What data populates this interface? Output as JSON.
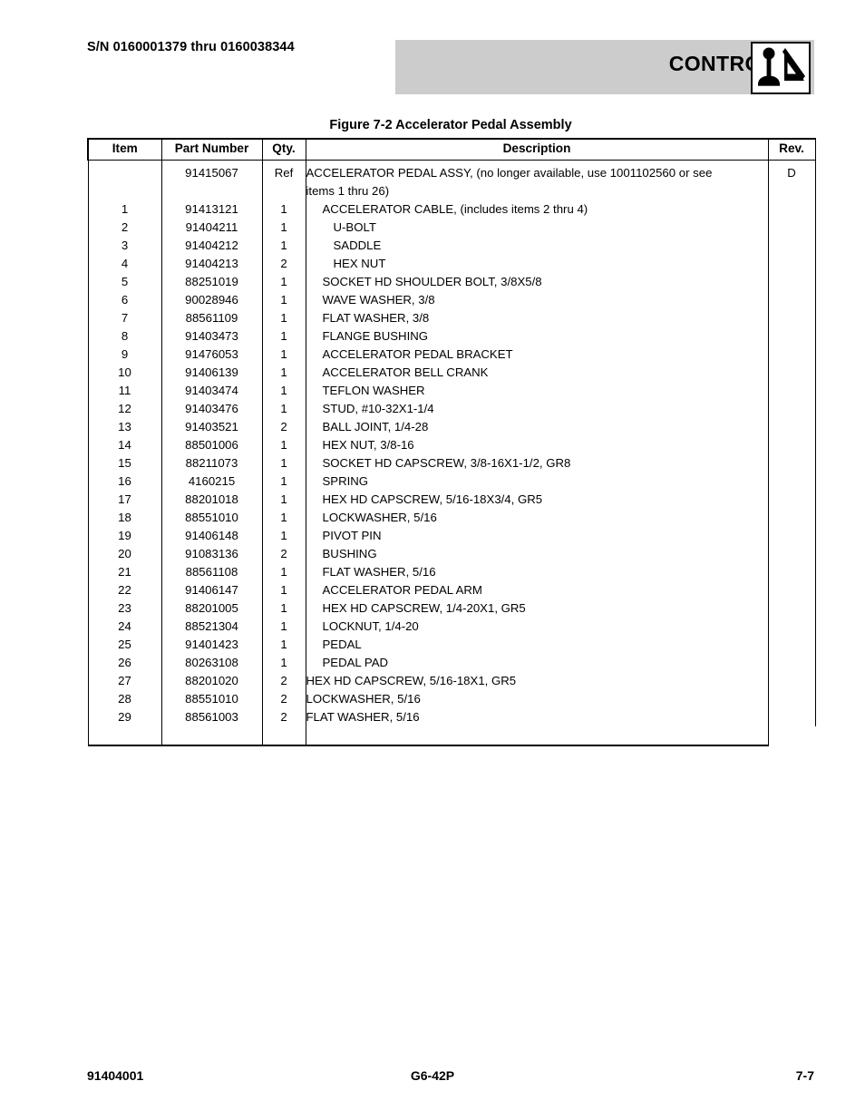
{
  "header": {
    "serial_range": "S/N 0160001379 thru 0160038344",
    "section_title": "CONTROLS",
    "icon_name": "controls-joystick-boom-icon",
    "banner_color": "#cccccc"
  },
  "figure": {
    "title": "Figure 7-2 Accelerator Pedal Assembly"
  },
  "table": {
    "columns": {
      "item": "Item",
      "part_number": "Part Number",
      "qty": "Qty.",
      "description": "Description",
      "rev": "Rev."
    },
    "rows": [
      {
        "item": "",
        "part": "91415067",
        "qty": "Ref",
        "desc": "ACCELERATOR PEDAL ASSY, (no longer available, use 1001102560 or see",
        "desc2": "items 1 thru 26)",
        "indent": 0,
        "rev": "D"
      },
      {
        "item": "1",
        "part": "91413121",
        "qty": "1",
        "desc": "ACCELERATOR CABLE, (includes items 2 thru 4)",
        "indent": 1,
        "rev": ""
      },
      {
        "item": "2",
        "part": "91404211",
        "qty": "1",
        "desc": "U-BOLT",
        "indent": 2,
        "rev": ""
      },
      {
        "item": "3",
        "part": "91404212",
        "qty": "1",
        "desc": "SADDLE",
        "indent": 2,
        "rev": ""
      },
      {
        "item": "4",
        "part": "91404213",
        "qty": "2",
        "desc": "HEX NUT",
        "indent": 2,
        "rev": ""
      },
      {
        "item": "5",
        "part": "88251019",
        "qty": "1",
        "desc": "SOCKET HD SHOULDER BOLT, 3/8X5/8",
        "indent": 1,
        "rev": ""
      },
      {
        "item": "6",
        "part": "90028946",
        "qty": "1",
        "desc": "WAVE WASHER, 3/8",
        "indent": 1,
        "rev": ""
      },
      {
        "item": "7",
        "part": "88561109",
        "qty": "1",
        "desc": "FLAT WASHER, 3/8",
        "indent": 1,
        "rev": ""
      },
      {
        "item": "8",
        "part": "91403473",
        "qty": "1",
        "desc": "FLANGE BUSHING",
        "indent": 1,
        "rev": ""
      },
      {
        "item": "9",
        "part": "91476053",
        "qty": "1",
        "desc": "ACCELERATOR PEDAL BRACKET",
        "indent": 1,
        "rev": ""
      },
      {
        "item": "10",
        "part": "91406139",
        "qty": "1",
        "desc": "ACCELERATOR BELL CRANK",
        "indent": 1,
        "rev": ""
      },
      {
        "item": "11",
        "part": "91403474",
        "qty": "1",
        "desc": "TEFLON WASHER",
        "indent": 1,
        "rev": ""
      },
      {
        "item": "12",
        "part": "91403476",
        "qty": "1",
        "desc": "STUD, #10-32X1-1/4",
        "indent": 1,
        "rev": ""
      },
      {
        "item": "13",
        "part": "91403521",
        "qty": "2",
        "desc": "BALL JOINT, 1/4-28",
        "indent": 1,
        "rev": ""
      },
      {
        "item": "14",
        "part": "88501006",
        "qty": "1",
        "desc": "HEX NUT, 3/8-16",
        "indent": 1,
        "rev": ""
      },
      {
        "item": "15",
        "part": "88211073",
        "qty": "1",
        "desc": "SOCKET HD CAPSCREW, 3/8-16X1-1/2, GR8",
        "indent": 1,
        "rev": ""
      },
      {
        "item": "16",
        "part": "4160215",
        "qty": "1",
        "desc": "SPRING",
        "indent": 1,
        "rev": ""
      },
      {
        "item": "17",
        "part": "88201018",
        "qty": "1",
        "desc": "HEX HD CAPSCREW, 5/16-18X3/4, GR5",
        "indent": 1,
        "rev": ""
      },
      {
        "item": "18",
        "part": "88551010",
        "qty": "1",
        "desc": "LOCKWASHER, 5/16",
        "indent": 1,
        "rev": ""
      },
      {
        "item": "19",
        "part": "91406148",
        "qty": "1",
        "desc": "PIVOT PIN",
        "indent": 1,
        "rev": ""
      },
      {
        "item": "20",
        "part": "91083136",
        "qty": "2",
        "desc": "BUSHING",
        "indent": 1,
        "rev": ""
      },
      {
        "item": "21",
        "part": "88561108",
        "qty": "1",
        "desc": "FLAT WASHER, 5/16",
        "indent": 1,
        "rev": ""
      },
      {
        "item": "22",
        "part": "91406147",
        "qty": "1",
        "desc": "ACCELERATOR PEDAL ARM",
        "indent": 1,
        "rev": ""
      },
      {
        "item": "23",
        "part": "88201005",
        "qty": "1",
        "desc": "HEX HD CAPSCREW, 1/4-20X1, GR5",
        "indent": 1,
        "rev": ""
      },
      {
        "item": "24",
        "part": "88521304",
        "qty": "1",
        "desc": "LOCKNUT, 1/4-20",
        "indent": 1,
        "rev": ""
      },
      {
        "item": "25",
        "part": "91401423",
        "qty": "1",
        "desc": "PEDAL",
        "indent": 1,
        "rev": ""
      },
      {
        "item": "26",
        "part": "80263108",
        "qty": "1",
        "desc": "PEDAL PAD",
        "indent": 1,
        "rev": ""
      },
      {
        "item": "27",
        "part": "88201020",
        "qty": "2",
        "desc": "HEX HD CAPSCREW, 5/16-18X1, GR5",
        "indent": 0,
        "rev": ""
      },
      {
        "item": "28",
        "part": "88551010",
        "qty": "2",
        "desc": "LOCKWASHER, 5/16",
        "indent": 0,
        "rev": ""
      },
      {
        "item": "29",
        "part": "88561003",
        "qty": "2",
        "desc": "FLAT WASHER, 5/16",
        "indent": 0,
        "rev": ""
      }
    ]
  },
  "footer": {
    "left": "91404001",
    "center": "G6-42P",
    "right": "7-7"
  }
}
